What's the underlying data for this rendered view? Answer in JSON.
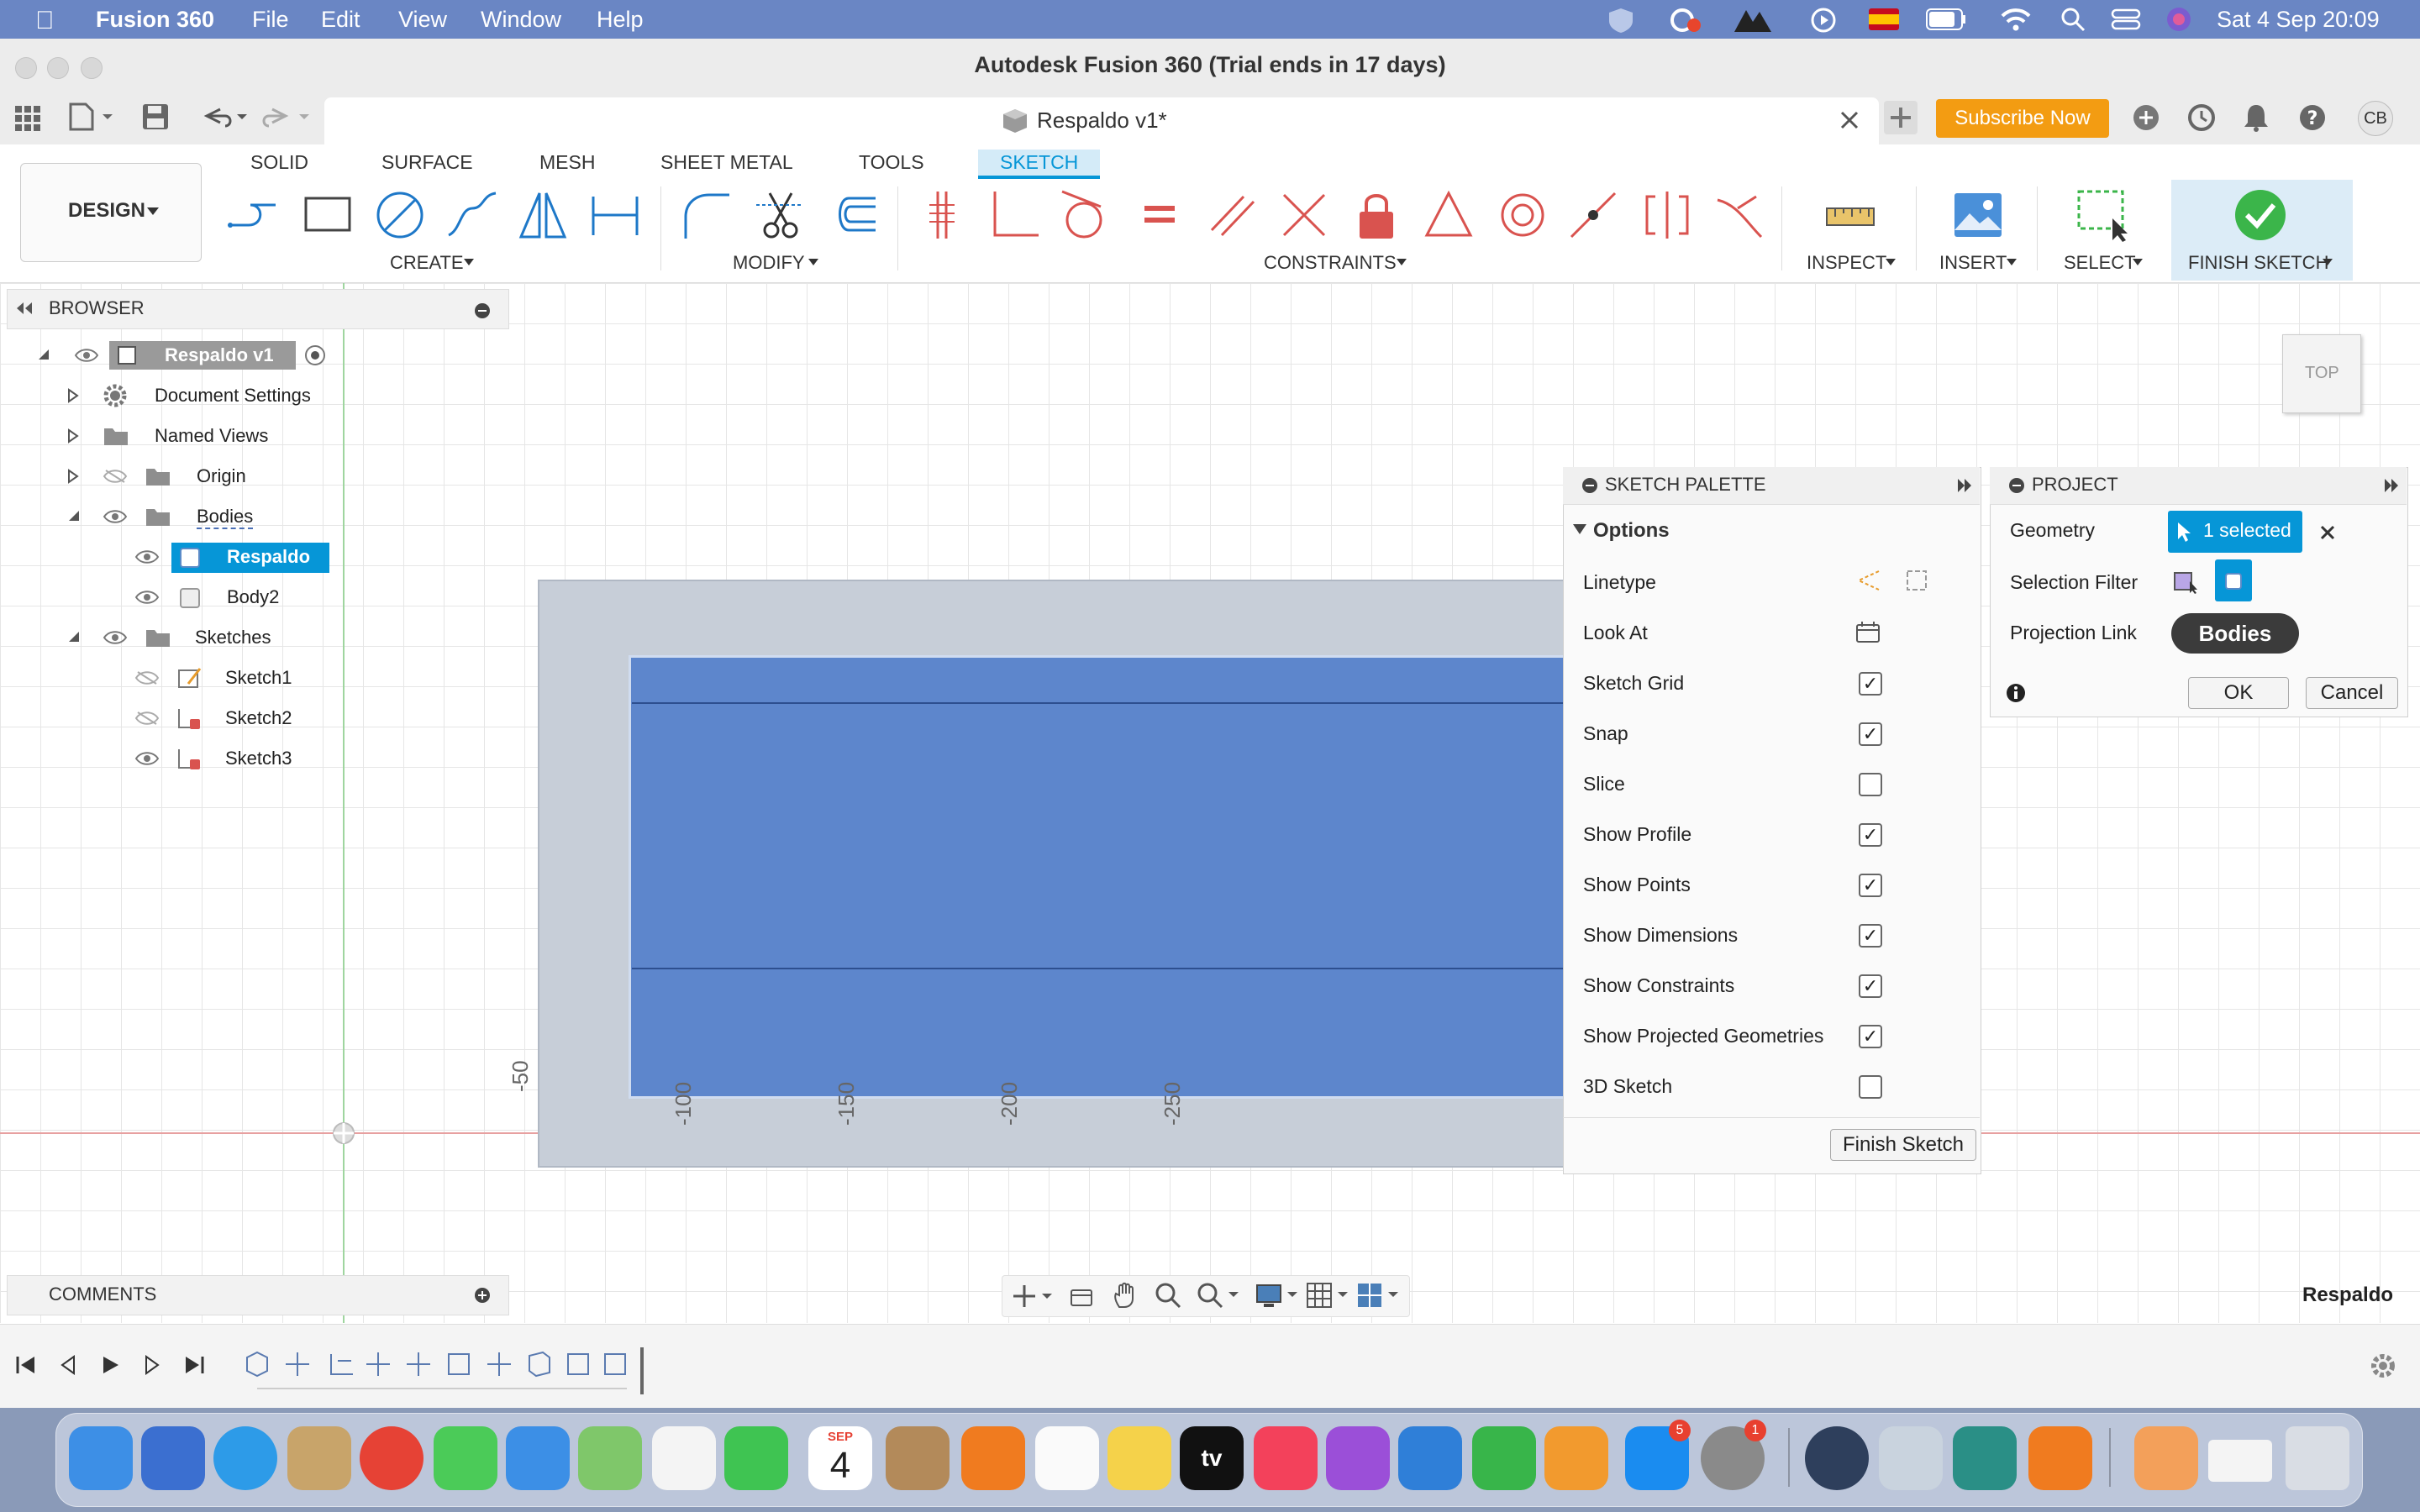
{
  "menubar": {
    "app_name": "Fusion 360",
    "items": [
      "File",
      "Edit",
      "View",
      "Window",
      "Help"
    ],
    "datetime": "Sat 4 Sep  20:09"
  },
  "window": {
    "title": "Autodesk Fusion 360 (Trial ends in 17 days)"
  },
  "tabbar": {
    "doc_tab": "Respaldo v1*",
    "subscribe": "Subscribe Now",
    "user_initials": "CB"
  },
  "ribbon": {
    "workspace": "DESIGN",
    "tabs": [
      "SOLID",
      "SURFACE",
      "MESH",
      "SHEET METAL",
      "TOOLS",
      "SKETCH"
    ],
    "active_tab": "SKETCH",
    "groups": {
      "create": "CREATE",
      "modify": "MODIFY",
      "constraints": "CONSTRAINTS",
      "inspect": "INSPECT",
      "insert": "INSERT",
      "select": "SELECT",
      "finish": "FINISH SKETCH"
    }
  },
  "browser": {
    "title": "BROWSER",
    "items": [
      {
        "label": "Respaldo v1"
      },
      {
        "label": "Document Settings"
      },
      {
        "label": "Named Views"
      },
      {
        "label": "Origin"
      },
      {
        "label": "Bodies"
      },
      {
        "label": "Respaldo"
      },
      {
        "label": "Body2"
      },
      {
        "label": "Sketches"
      },
      {
        "label": "Sketch1"
      },
      {
        "label": "Sketch2"
      },
      {
        "label": "Sketch3"
      }
    ]
  },
  "comments": {
    "title": "COMMENTS"
  },
  "viewcube": {
    "label": "TOP"
  },
  "axis_labels": [
    "-50",
    "-100",
    "-150",
    "-200",
    "-250"
  ],
  "sketch_palette": {
    "title": "SKETCH PALETTE",
    "section": "Options",
    "rows": [
      {
        "label": "Linetype"
      },
      {
        "label": "Look At"
      },
      {
        "label": "Sketch Grid",
        "checked": true
      },
      {
        "label": "Snap",
        "checked": true
      },
      {
        "label": "Slice",
        "checked": false
      },
      {
        "label": "Show Profile",
        "checked": true
      },
      {
        "label": "Show Points",
        "checked": true
      },
      {
        "label": "Show Dimensions",
        "checked": true
      },
      {
        "label": "Show Constraints",
        "checked": true
      },
      {
        "label": "Show Projected Geometries",
        "checked": true
      },
      {
        "label": "3D Sketch",
        "checked": false
      }
    ],
    "finish_button": "Finish Sketch"
  },
  "project": {
    "title": "PROJECT",
    "geometry_label": "Geometry",
    "geometry_value": "1 selected",
    "filter_label": "Selection Filter",
    "link_label": "Projection Link",
    "tooltip": "Bodies",
    "ok": "OK",
    "cancel": "Cancel"
  },
  "status": {
    "selection_name": "Respaldo"
  },
  "dock": {
    "calendar_month": "SEP",
    "calendar_day": "4",
    "appstore_badge": "5",
    "settings_badge": "1",
    "tv_label": "tv"
  },
  "colors": {
    "accent": "#0696d7",
    "menubar": "#6a86c4",
    "subscribe": "#f39c12",
    "finish_green": "#3bb54a",
    "body_blue": "#5d86cc",
    "lock_red": "#d9534f"
  }
}
